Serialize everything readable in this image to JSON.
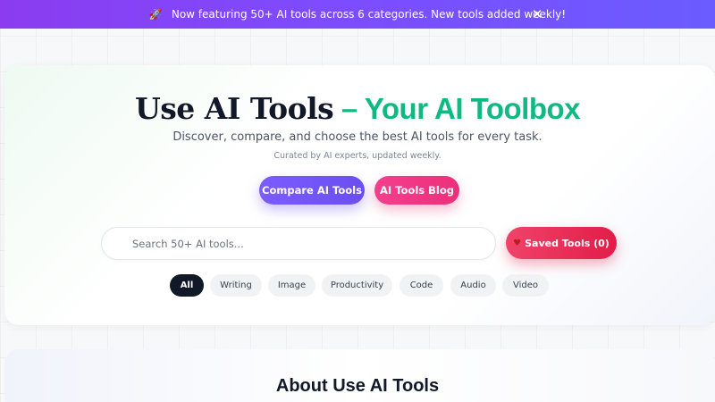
{
  "banner": {
    "icon": "rocket-icon",
    "text": "Now featuring 50+ AI tools across 6 categories. New tools added weekly!",
    "close_icon": "close-icon",
    "close_glyph": "✕"
  },
  "hero": {
    "title_brand": "Use AI Tools",
    "title_accent": " – Your AI Toolbox",
    "subtitle": "Discover, compare, and choose the best AI tools for every task.",
    "tagline": "Curated by AI experts, updated weekly.",
    "buttons": {
      "compare": "Compare AI Tools",
      "blog": "AI Tools Blog"
    }
  },
  "search": {
    "placeholder": "Search 50+ AI tools...",
    "value": ""
  },
  "saved": {
    "icon": "heart-icon",
    "label": "Saved Tools (0)"
  },
  "categories": {
    "items": [
      "All",
      "Writing",
      "Image",
      "Productivity",
      "Code",
      "Audio",
      "Video"
    ],
    "selected": "All"
  },
  "about": {
    "title": "About Use AI Tools"
  },
  "colors": {
    "banner_gradient": [
      "#8b3cf0",
      "#6a5cff"
    ],
    "accent_green": "#10b981",
    "compare_button": "#7b5cff",
    "blog_button": "#f43f8e",
    "saved_button": "#e11d48",
    "active_chip": "#111827"
  }
}
